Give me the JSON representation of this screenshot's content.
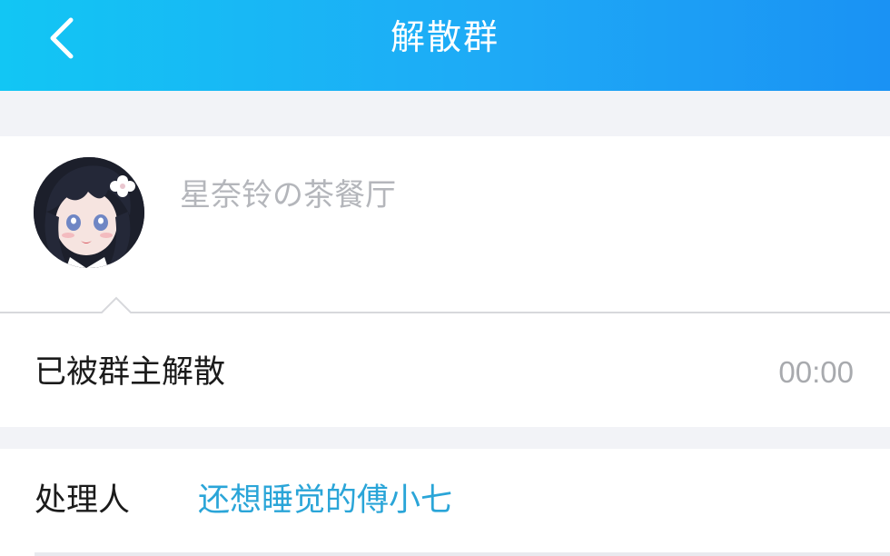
{
  "header": {
    "title": "解散群",
    "back_icon": "chevron-left-icon",
    "gradient": [
      "#12c6f4",
      "#1a92f4"
    ]
  },
  "group": {
    "name": "星奈铃の茶餐厅",
    "avatar": "anime-girl-avatar"
  },
  "status": {
    "text": "已被群主解散",
    "time": "00:00"
  },
  "handler": {
    "label": "处理人",
    "name": "还想睡觉的傅小七",
    "name_color": "#2aa5d8"
  }
}
